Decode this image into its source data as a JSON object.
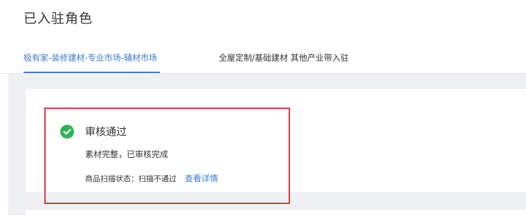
{
  "page": {
    "title": "已入驻角色"
  },
  "tabs": [
    {
      "label": "极有家-装修建材-专业市场-辅材市场",
      "active": true
    },
    {
      "label": "全屋定制/基础建材 其他产业带入驻",
      "active": false
    }
  ],
  "status_card": {
    "icon": "check-circle-icon",
    "title": "审核通过",
    "description": "素材完整，已审核完成",
    "scan_status_label": "商品扫描状态：扫描不通过",
    "view_detail_label": "查看详情"
  },
  "colors": {
    "accent": "#3a7bd5",
    "success": "#2fb553",
    "highlight": "#d9363e",
    "background": "#eef0f3"
  }
}
